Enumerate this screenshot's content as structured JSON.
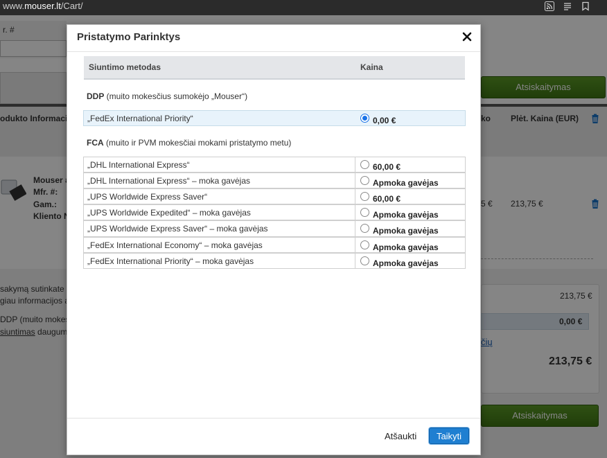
{
  "browser": {
    "url_prefix": "www.",
    "url_domain": "mouser.lt",
    "url_path": "/Cart/"
  },
  "background": {
    "mfr_col": "r. #",
    "checkout_label": "Atsiskaitymas",
    "product_info_header": "odukto Informaci",
    "discount_col": "ko",
    "ext_price_header": "Plėt. Kaina (EUR)",
    "product_line1": "Mouser #:",
    "product_line2": "Mfr. #:",
    "product_line3": "Gam.:",
    "product_line4": "Kliento N",
    "unit_price_partial": "5 €",
    "ext_price_value": "213,75 €",
    "terms_line1": "sakymą sutinkate",
    "terms_line2": "giau informacijos a",
    "ddp_note_partial": "DDP (muito mokesč",
    "shipping_link_partial": "siuntimas",
    "shipping_link_rest": " daugum",
    "subtotal": "213,75 €",
    "shipping_value": "0,00 €",
    "link_partial": "čių",
    "total": "213,75 €"
  },
  "modal": {
    "title": "Pristatymo Parinktys",
    "col_method": "Siuntimo metodas",
    "col_price": "Kaina",
    "ddp_label": "DDP",
    "ddp_desc": " (muito mokesčius sumokėjo „Mouser“)",
    "fca_label": "FCA",
    "fca_desc": " (muito ir PVM mokesčiai mokami pristatymo metu)",
    "ddp_options": [
      {
        "name": "„FedEx International Priority“",
        "price": "0,00 €",
        "selected": true
      }
    ],
    "fca_options": [
      {
        "name": "„DHL International Express“",
        "price": "60,00 €",
        "selected": false
      },
      {
        "name": "„DHL International Express“ – moka gavėjas",
        "price": "Apmoka gavėjas",
        "selected": false
      },
      {
        "name": "„UPS Worldwide Express Saver“",
        "price": "60,00 €",
        "selected": false
      },
      {
        "name": "„UPS Worldwide Expedited“ – moka gavėjas",
        "price": "Apmoka gavėjas",
        "selected": false
      },
      {
        "name": "„UPS Worldwide Express Saver“ – moka gavėjas",
        "price": "Apmoka gavėjas",
        "selected": false
      },
      {
        "name": "„FedEx International Economy“ – moka gavėjas",
        "price": "Apmoka gavėjas",
        "selected": false
      },
      {
        "name": "„FedEx International Priority“ – moka gavėjas",
        "price": "Apmoka gavėjas",
        "selected": false
      }
    ],
    "cancel_label": "Atšaukti",
    "apply_label": "Taikyti"
  },
  "colors": {
    "primary_button": "#1f7fd1",
    "checkout_green": "#4e8a1e",
    "selected_row": "#e8f3fb"
  }
}
